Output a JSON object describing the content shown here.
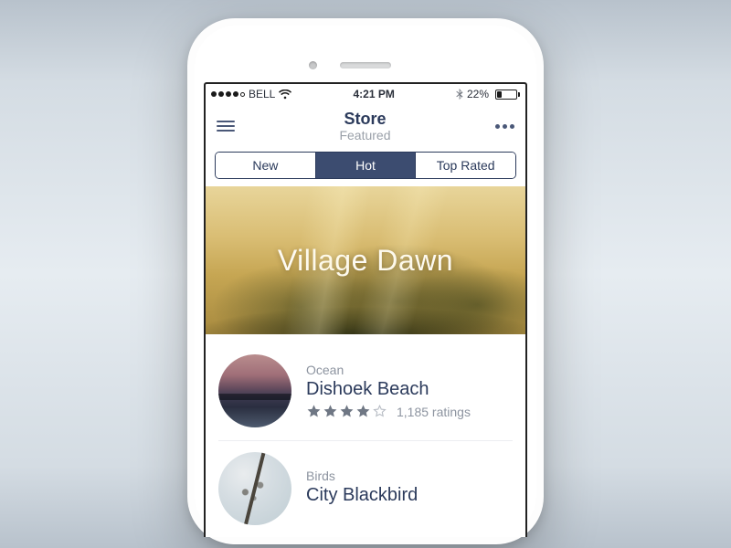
{
  "status": {
    "carrier": "BELL",
    "time": "4:21 PM",
    "battery_pct": "22%"
  },
  "nav": {
    "title": "Store",
    "subtitle": "Featured"
  },
  "tabs": {
    "new": "New",
    "hot": "Hot",
    "top": "Top Rated"
  },
  "hero": {
    "title": "Village Dawn"
  },
  "items": [
    {
      "category": "Ocean",
      "title": "Dishoek Beach",
      "stars": 4,
      "ratings": "1,185 ratings"
    },
    {
      "category": "Birds",
      "title": "City Blackbird"
    }
  ]
}
